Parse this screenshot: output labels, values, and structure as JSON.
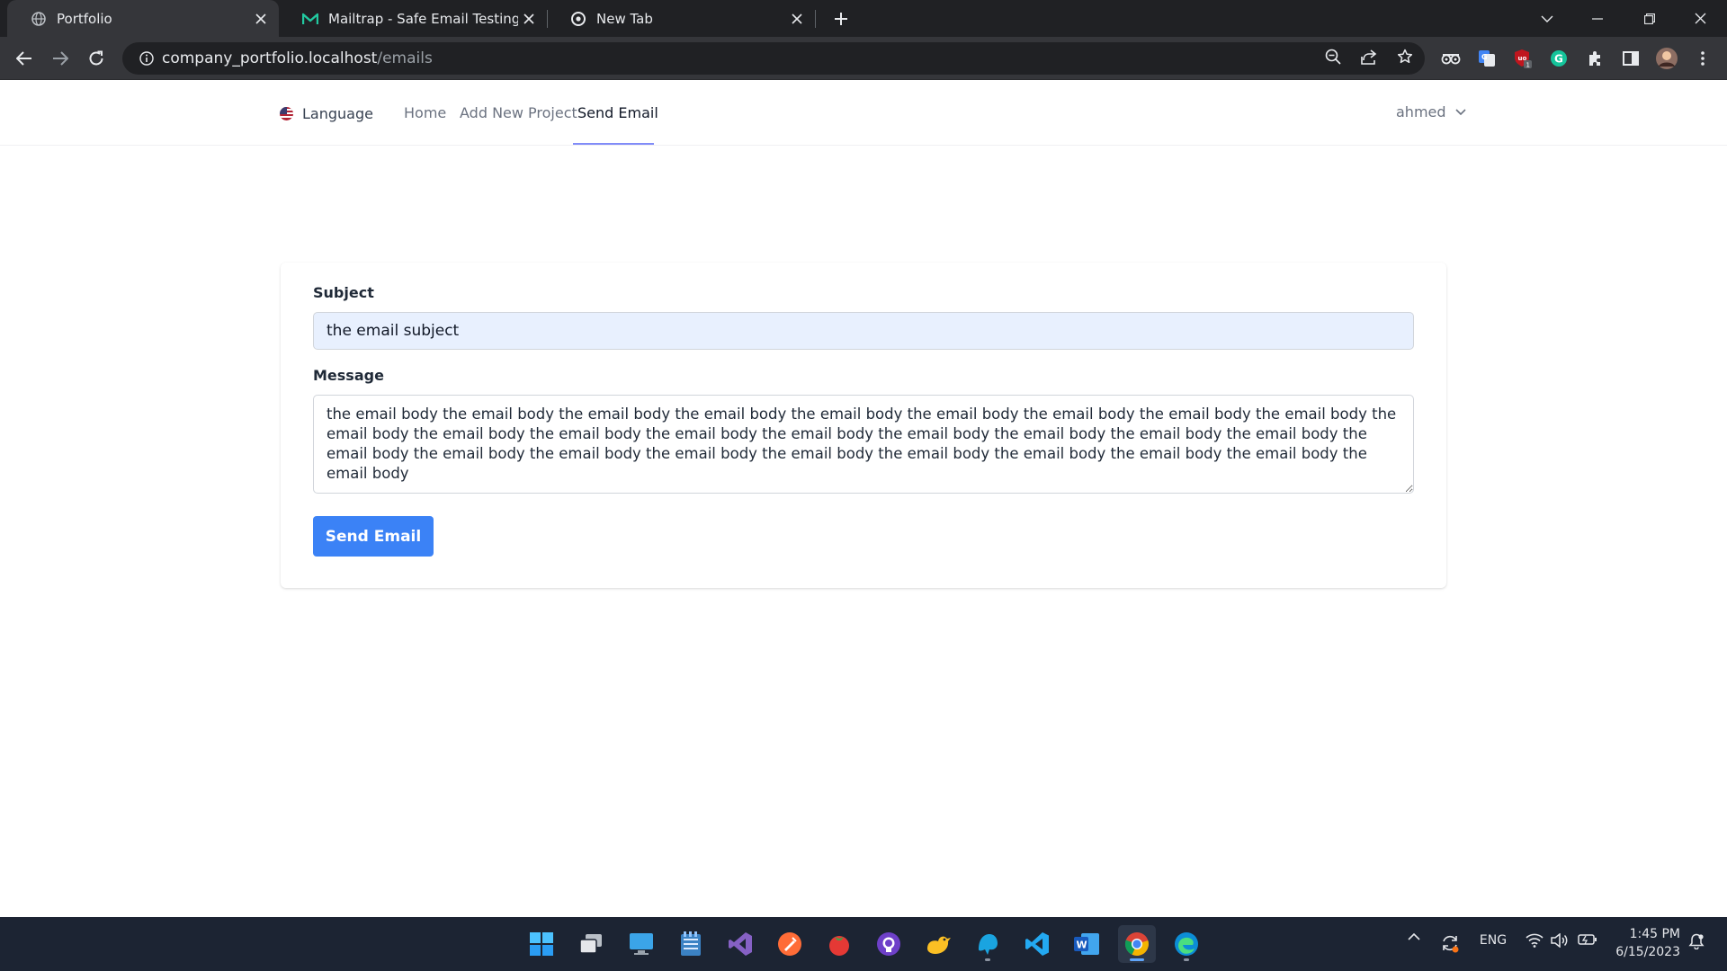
{
  "browser": {
    "tabs": [
      {
        "title": "Portfolio",
        "active": true
      },
      {
        "title": "Mailtrap - Safe Email Testing",
        "active": false
      },
      {
        "title": "New Tab",
        "active": false
      }
    ],
    "address": {
      "host": "company_portfolio.localhost",
      "path": "/emails"
    }
  },
  "navbar": {
    "language_label": "Language",
    "links": [
      "Home",
      "Add New Project",
      "Send Email"
    ],
    "active_link": "Send Email",
    "user_name": "ahmed"
  },
  "form": {
    "subject_label": "Subject",
    "subject_value": "the email subject",
    "message_label": "Message",
    "message_value": "the email body the email body the email body the email body the email body the email body the email body the email body the email body the email body the email body the email body the email body the email body the email body the email body the email body the email body the email body the email body the email body the email body the email body the email body the email body the email body the email body the email body",
    "submit_label": "Send Email"
  },
  "taskbar": {
    "language": "ENG",
    "time": "1:45 PM",
    "date": "6/15/2023"
  },
  "colors": {
    "primary_button": "#3b82f6",
    "active_underline": "#818cf8",
    "input_autofill": "#e8f0fe",
    "taskbar_bg": "#1c2433",
    "chrome_bg": "#202124"
  }
}
